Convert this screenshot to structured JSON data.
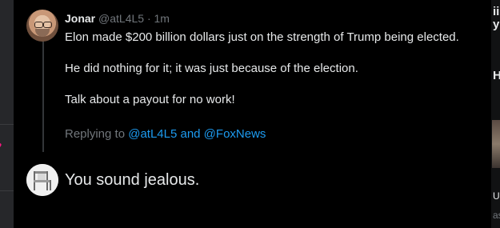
{
  "tweet": {
    "author_name": "Jonar",
    "handle_time": "@atL4L5 · 1m",
    "paragraphs": [
      "Elon made $200 billion dollars just on the strength of Trump being elected.",
      "He did nothing for it; it was just because of the election.",
      "Talk about a payout for no work!"
    ]
  },
  "replying": {
    "prefix": "Replying to ",
    "targets": "@atL4L5 and @FoxNews"
  },
  "reply": {
    "text": "You sound jealous."
  },
  "right_strip": {
    "t1": "ii",
    "t2": "y",
    "t3": "H",
    "t4": "U",
    "t5": "as"
  },
  "colors": {
    "background": "#000000",
    "text": "#e7e9ea",
    "muted": "#71767b",
    "link": "#1d9bf0",
    "like_pink": "#f91880"
  },
  "icons": [
    "avatar-jonar",
    "avatar-chair",
    "heart-icon"
  ]
}
